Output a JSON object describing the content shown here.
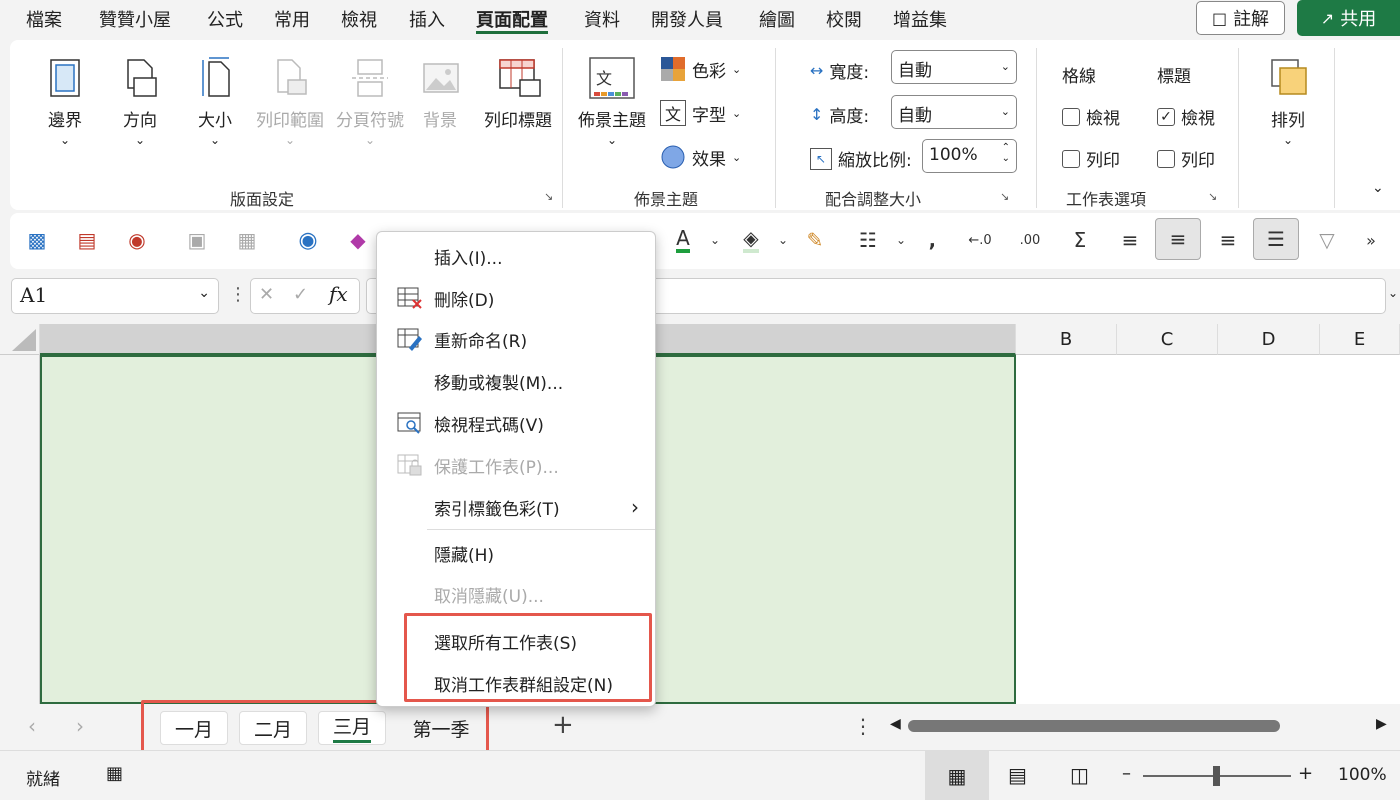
{
  "menu": {
    "tabs": [
      "檔案",
      "贊贊小屋",
      "公式",
      "常用",
      "檢視",
      "插入",
      "頁面配置",
      "資料",
      "開發人員",
      "繪圖",
      "校閱",
      "增益集"
    ],
    "active": "頁面配置",
    "comment_label": "註解",
    "share_label": "共用"
  },
  "ribbon": {
    "page_setup": {
      "label": "版面設定",
      "margins": "邊界",
      "orientation": "方向",
      "size": "大小",
      "print_area": "列印範圍",
      "breaks": "分頁符號",
      "background": "背景",
      "print_titles": "列印標題"
    },
    "themes": {
      "label": "佈景主題",
      "theme": "佈景主題",
      "colors": "色彩",
      "fonts": "字型",
      "effects": "效果"
    },
    "scale": {
      "label": "配合調整大小",
      "width_label": "寬度:",
      "width_value": "自動",
      "height_label": "高度:",
      "height_value": "自動",
      "scale_label": "縮放比例:",
      "scale_value": "100%"
    },
    "sheet_options": {
      "label": "工作表選項",
      "gridlines": "格線",
      "headings": "標題",
      "view": "檢視",
      "print": "列印",
      "gridlines_view": false,
      "gridlines_print": false,
      "headings_view": true,
      "headings_print": false
    },
    "arrange": {
      "label": "排列"
    }
  },
  "formula": {
    "name_box": "A1",
    "fx": "fx"
  },
  "grid": {
    "columns": [
      "B",
      "C",
      "D",
      "E"
    ]
  },
  "context_menu": {
    "items": [
      {
        "label": "插入(I)...",
        "enabled": true,
        "icon": ""
      },
      {
        "label": "刪除(D)",
        "enabled": true,
        "icon": "delete-sheet-icon"
      },
      {
        "label": "重新命名(R)",
        "enabled": true,
        "icon": "rename-sheet-icon"
      },
      {
        "label": "移動或複製(M)...",
        "enabled": true,
        "icon": ""
      },
      {
        "label": "檢視程式碼(V)",
        "enabled": true,
        "icon": "view-code-icon"
      },
      {
        "label": "保護工作表(P)...",
        "enabled": false,
        "icon": "protect-sheet-icon"
      },
      {
        "label": "索引標籤色彩(T)",
        "enabled": true,
        "icon": "",
        "submenu": true
      },
      {
        "label": "隱藏(H)",
        "enabled": true,
        "icon": ""
      },
      {
        "label": "取消隱藏(U)...",
        "enabled": false,
        "icon": ""
      },
      {
        "label": "選取所有工作表(S)",
        "enabled": true,
        "icon": ""
      },
      {
        "label": "取消工作表群組設定(N)",
        "enabled": true,
        "icon": ""
      }
    ]
  },
  "sheets": {
    "tabs": [
      "一月",
      "二月",
      "三月",
      "第一季"
    ],
    "active": "三月"
  },
  "status": {
    "ready": "就緒",
    "zoom": "100%"
  },
  "colors": {
    "accent": "#1e7a45",
    "highlight": "#e4574c",
    "selection_fill": "#e2efdc"
  }
}
